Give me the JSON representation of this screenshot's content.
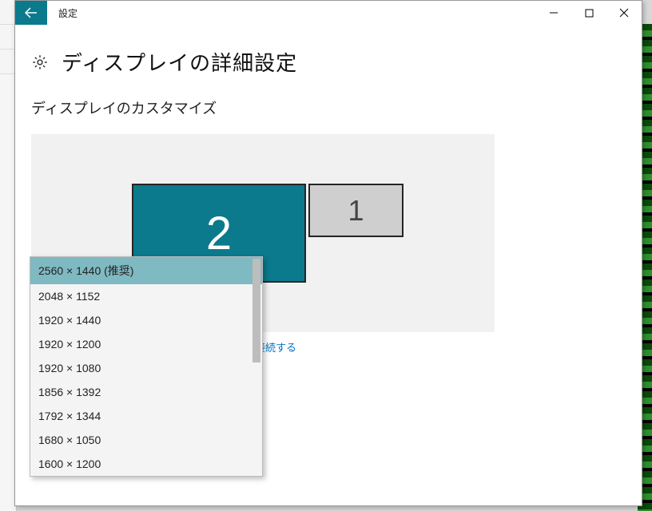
{
  "window": {
    "title": "設定",
    "controls": {
      "min": "–",
      "max": "☐",
      "close": "✕"
    }
  },
  "page": {
    "title": "ディスプレイの詳細設定",
    "section_title": "ディスプレイのカスタマイズ"
  },
  "displays": {
    "selected_label": "2",
    "other_label": "1"
  },
  "wireless_link": "接続する",
  "resolution_dropdown": {
    "selected_index": 0,
    "options": [
      "2560 × 1440 (推奨)",
      "2048 × 1152",
      "1920 × 1440",
      "1920 × 1200",
      "1920 × 1080",
      "1856 × 1392",
      "1792 × 1344",
      "1680 × 1050",
      "1600 × 1200"
    ]
  },
  "colors": {
    "accent": "#0a7a8c",
    "link": "#0073c7"
  }
}
